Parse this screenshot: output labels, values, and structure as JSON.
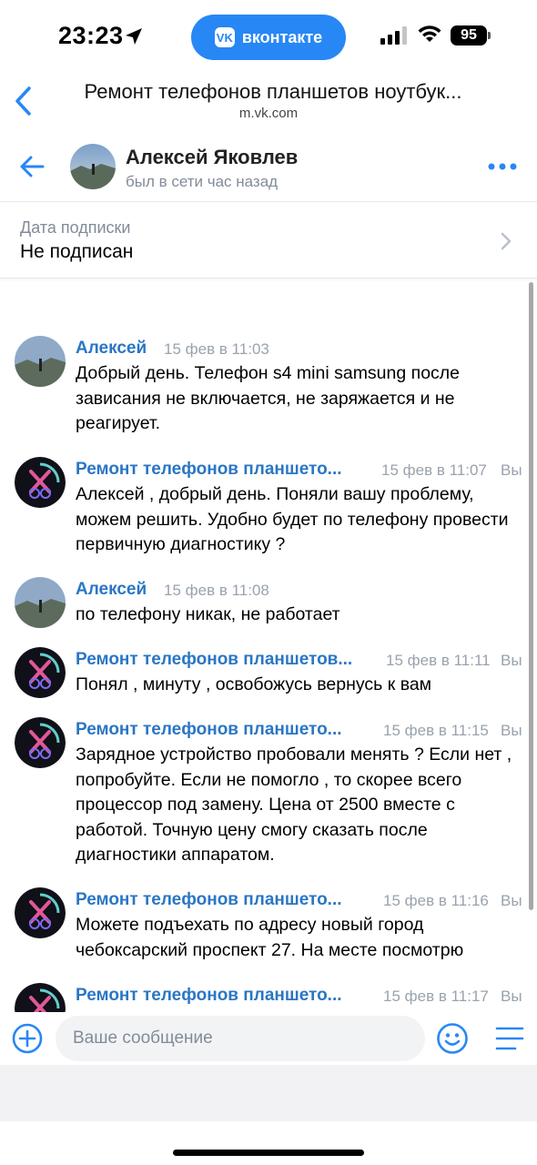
{
  "status_bar": {
    "time": "23:23",
    "app_pill_label": "вконтакте",
    "app_pill_logo": "VK",
    "battery": "95"
  },
  "browser": {
    "title": "Ремонт телефонов планшетов ноутбук...",
    "url": "m.vk.com"
  },
  "chat_header": {
    "name": "Алексей Яковлев",
    "status": "был в сети час назад"
  },
  "subscription": {
    "label": "Дата подписки",
    "value": "Не подписан"
  },
  "messages": [
    {
      "author": "Алексей",
      "time": "15 фев в 11:03",
      "you": "",
      "text": "Добрый день. Телефон s4 mini samsung после зависания не включается, не заряжается и не реагирует."
    },
    {
      "author": "Ремонт телефонов планшето...",
      "time": "15 фев в 11:07",
      "you": "Вы",
      "text": "Алексей , добрый день. Поняли вашу проблему, можем решить. Удобно будет по телефону провести первичную диагностику ?"
    },
    {
      "author": "Алексей",
      "time": "15 фев в 11:08",
      "you": "",
      "text": "по телефону никак, не работает"
    },
    {
      "author": "Ремонт телефонов планшетов...",
      "time": "15 фев в 11:11",
      "you": "Вы",
      "text": "Понял , минуту , освобожусь вернусь к вам"
    },
    {
      "author": "Ремонт телефонов планшето...",
      "time": "15 фев в 11:15",
      "you": "Вы",
      "text": "Зарядное устройство пробовали менять ? Если нет , попробуйте. Если не помогло , то скорее всего процессор под замену. Цена от 2500 вместе с работой. Точную цену смогу сказать после диагностики аппаратом."
    },
    {
      "author": "Ремонт телефонов планшето...",
      "time": "15 фев в 11:16",
      "you": "Вы",
      "text": "Можете подъехать по адресу новый город чебоксарский проспект 27. На месте посмотрю"
    },
    {
      "author": "Ремонт телефонов планшето...",
      "time": "15 фев в 11:17",
      "you": "Вы",
      "text": ""
    }
  ],
  "composer": {
    "placeholder": "Ваше сообщение"
  },
  "icons": {
    "status": [
      "location-arrow-icon",
      "cellular-signal-icon",
      "wifi-icon"
    ],
    "header": [
      "chevron-left-icon",
      "arrow-left-icon",
      "more-horizontal-icon"
    ],
    "composer": [
      "add-circle-icon",
      "smile-icon",
      "menu-icon"
    ]
  },
  "colors": {
    "accent": "#2787f5",
    "author_link": "#2a76c4",
    "secondary_text": "#818c99"
  }
}
